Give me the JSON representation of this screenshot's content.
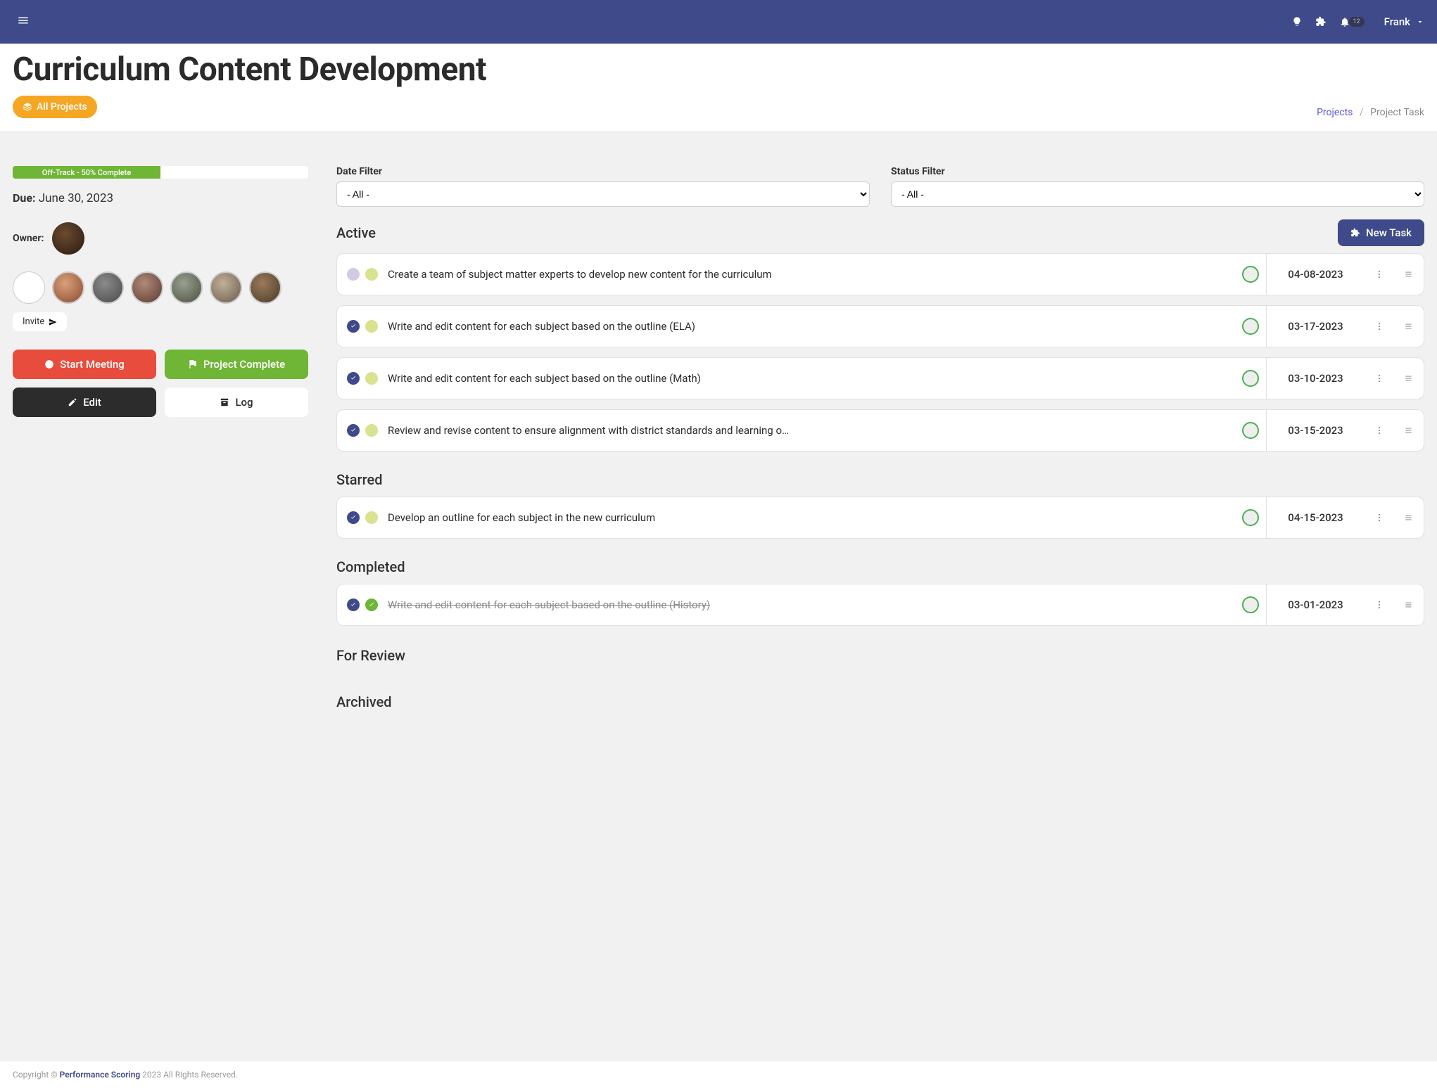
{
  "topbar": {
    "notifications_badge": "12",
    "user_name": "Frank"
  },
  "page": {
    "title": "Curriculum Content Development",
    "all_projects_label": "All Projects",
    "breadcrumb_link": "Projects",
    "breadcrumb_current": "Project Task"
  },
  "left": {
    "progress": {
      "label": "Off-Track - 50% Complete",
      "percent": 50
    },
    "due_label": "Due:",
    "due_value": "June 30, 2023",
    "owner_label": "Owner:",
    "invite_label": "Invite",
    "actions": {
      "start_meeting": "Start Meeting",
      "project_complete": "Project Complete",
      "edit": "Edit",
      "log": "Log"
    }
  },
  "filters": {
    "date_label": "Date Filter",
    "date_value": "- All -",
    "status_label": "Status Filter",
    "status_value": "- All -"
  },
  "new_task_label": "New Task",
  "sections": {
    "active": {
      "title": "Active",
      "tasks": [
        {
          "title": "Create a team of subject matter experts to develop new content for the curriculum",
          "date": "04-08-2023",
          "started": false,
          "done": false
        },
        {
          "title": "Write and edit content for each subject based on the outline (ELA)",
          "date": "03-17-2023",
          "started": true,
          "done": false
        },
        {
          "title": "Write and edit content for each subject based on the outline (Math)",
          "date": "03-10-2023",
          "started": true,
          "done": false
        },
        {
          "title": "Review and revise content to ensure alignment with district standards and learning o…",
          "date": "03-15-2023",
          "started": true,
          "done": false
        }
      ]
    },
    "starred": {
      "title": "Starred",
      "tasks": [
        {
          "title": "Develop an outline for each subject in the new curriculum",
          "date": "04-15-2023",
          "started": true,
          "done": false
        }
      ]
    },
    "completed": {
      "title": "Completed",
      "tasks": [
        {
          "title": "Write and edit content for each subject based on the outline (History)",
          "date": "03-01-2023",
          "started": true,
          "done": true
        }
      ]
    },
    "for_review": {
      "title": "For Review",
      "tasks": []
    },
    "archived": {
      "title": "Archived",
      "tasks": []
    }
  },
  "footer": {
    "prefix": "Copyright ©",
    "brand": "Performance Scoring",
    "suffix": "2023 All Rights Reserved."
  },
  "colors": {
    "primary": "#3e4a89",
    "accent_orange": "#f5a623",
    "success": "#6fb536",
    "danger": "#e74c3c"
  }
}
